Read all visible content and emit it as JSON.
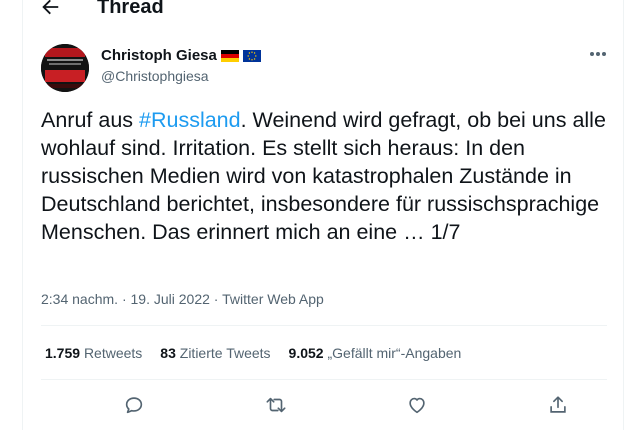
{
  "header": {
    "title": "Thread",
    "back_icon": "arrow-left-icon"
  },
  "tweet": {
    "author": {
      "name": "Christoph Giesa",
      "handle": "@Christophgiesa",
      "flags": [
        "german-flag",
        "eu-flag"
      ]
    },
    "text_before": "Anruf aus ",
    "hashtag": "#Russland",
    "text_after": ". Weinend wird gefragt, ob bei uns alle wohlauf sind. Irritation. Es stellt sich heraus: In den russischen Medien wird von katastrophalen Zustände in Deutschland berichtet, insbesondere für russischsprachige Menschen. Das erinnert mich an eine … 1/7",
    "time": "2:34 nachm.",
    "date": "19. Juli 2022",
    "source": "Twitter Web App",
    "separator": " · "
  },
  "stats": {
    "retweets": {
      "count": "1.759",
      "label": "Retweets"
    },
    "quotes": {
      "count": "83",
      "label": "Zitierte Tweets"
    },
    "likes": {
      "count": "9.052",
      "label": "„Gefällt mir“-Angaben"
    }
  },
  "actions": [
    "reply-icon",
    "retweet-icon",
    "like-icon",
    "share-icon"
  ],
  "colors": {
    "accent": "#1d9bf0",
    "secondary_text": "#536471",
    "divider": "#eff3f4"
  }
}
